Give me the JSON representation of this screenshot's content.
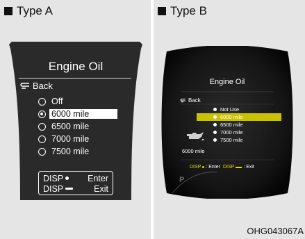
{
  "type_a": {
    "label": "Type A",
    "title": "Engine Oil",
    "back": "Back",
    "options": [
      {
        "label": "Off",
        "selected": false
      },
      {
        "label": "6000 mile",
        "selected": true
      },
      {
        "label": "6500 mile",
        "selected": false
      },
      {
        "label": "7000 mile",
        "selected": false
      },
      {
        "label": "7500 mile",
        "selected": false
      }
    ],
    "disp_enter_key": "DISP",
    "disp_enter_action": "Enter",
    "disp_exit_key": "DISP",
    "disp_exit_action": "Exit"
  },
  "type_b": {
    "label": "Type B",
    "title": "Engine Oil",
    "back": "Back",
    "options": [
      {
        "label": "Not Use",
        "selected": false
      },
      {
        "label": "6000 mile",
        "selected": true
      },
      {
        "label": "6500 mile",
        "selected": false
      },
      {
        "label": "7000 mile",
        "selected": false
      },
      {
        "label": "7500 mile",
        "selected": false
      }
    ],
    "current_value": "6000 mile",
    "disp_enter_key": "DISP",
    "disp_enter_action": ": Enter",
    "disp_exit_key": "DISP",
    "disp_exit_action": ": Exit",
    "gear_indicator": "P",
    "highlight_color": "#c9c200"
  },
  "reference_code": "OHG043067A"
}
